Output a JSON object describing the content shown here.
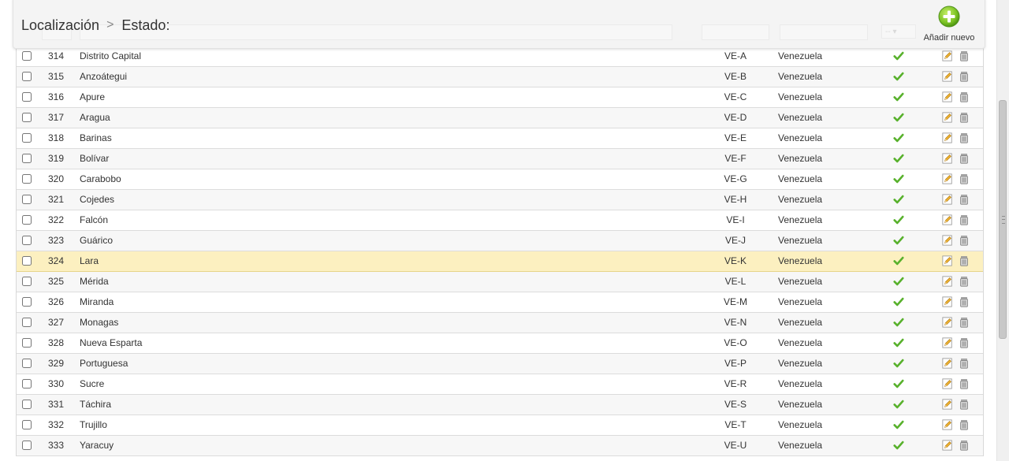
{
  "breadcrumb": {
    "parent": "Localización",
    "current": "Estado:"
  },
  "toolbar": {
    "add_label": "Añadir nuevo"
  },
  "filters": {
    "active_select": "--"
  },
  "colors": {
    "highlight_row": "#fcf0c0",
    "check_green": "#58b12c",
    "add_green": "#7cc324"
  },
  "rows": [
    {
      "id": "314",
      "name": "Distrito Capital",
      "iso": "VE-A",
      "zone": "Venezuela"
    },
    {
      "id": "315",
      "name": "Anzoátegui",
      "iso": "VE-B",
      "zone": "Venezuela"
    },
    {
      "id": "316",
      "name": "Apure",
      "iso": "VE-C",
      "zone": "Venezuela"
    },
    {
      "id": "317",
      "name": "Aragua",
      "iso": "VE-D",
      "zone": "Venezuela"
    },
    {
      "id": "318",
      "name": "Barinas",
      "iso": "VE-E",
      "zone": "Venezuela"
    },
    {
      "id": "319",
      "name": "Bolívar",
      "iso": "VE-F",
      "zone": "Venezuela"
    },
    {
      "id": "320",
      "name": "Carabobo",
      "iso": "VE-G",
      "zone": "Venezuela"
    },
    {
      "id": "321",
      "name": "Cojedes",
      "iso": "VE-H",
      "zone": "Venezuela"
    },
    {
      "id": "322",
      "name": "Falcón",
      "iso": "VE-I",
      "zone": "Venezuela"
    },
    {
      "id": "323",
      "name": "Guárico",
      "iso": "VE-J",
      "zone": "Venezuela"
    },
    {
      "id": "324",
      "name": "Lara",
      "iso": "VE-K",
      "zone": "Venezuela"
    },
    {
      "id": "325",
      "name": "Mérida",
      "iso": "VE-L",
      "zone": "Venezuela"
    },
    {
      "id": "326",
      "name": "Miranda",
      "iso": "VE-M",
      "zone": "Venezuela"
    },
    {
      "id": "327",
      "name": "Monagas",
      "iso": "VE-N",
      "zone": "Venezuela"
    },
    {
      "id": "328",
      "name": "Nueva Esparta",
      "iso": "VE-O",
      "zone": "Venezuela"
    },
    {
      "id": "329",
      "name": "Portuguesa",
      "iso": "VE-P",
      "zone": "Venezuela"
    },
    {
      "id": "330",
      "name": "Sucre",
      "iso": "VE-R",
      "zone": "Venezuela"
    },
    {
      "id": "331",
      "name": "Táchira",
      "iso": "VE-S",
      "zone": "Venezuela"
    },
    {
      "id": "332",
      "name": "Trujillo",
      "iso": "VE-T",
      "zone": "Venezuela"
    },
    {
      "id": "333",
      "name": "Yaracuy",
      "iso": "VE-U",
      "zone": "Venezuela"
    }
  ]
}
